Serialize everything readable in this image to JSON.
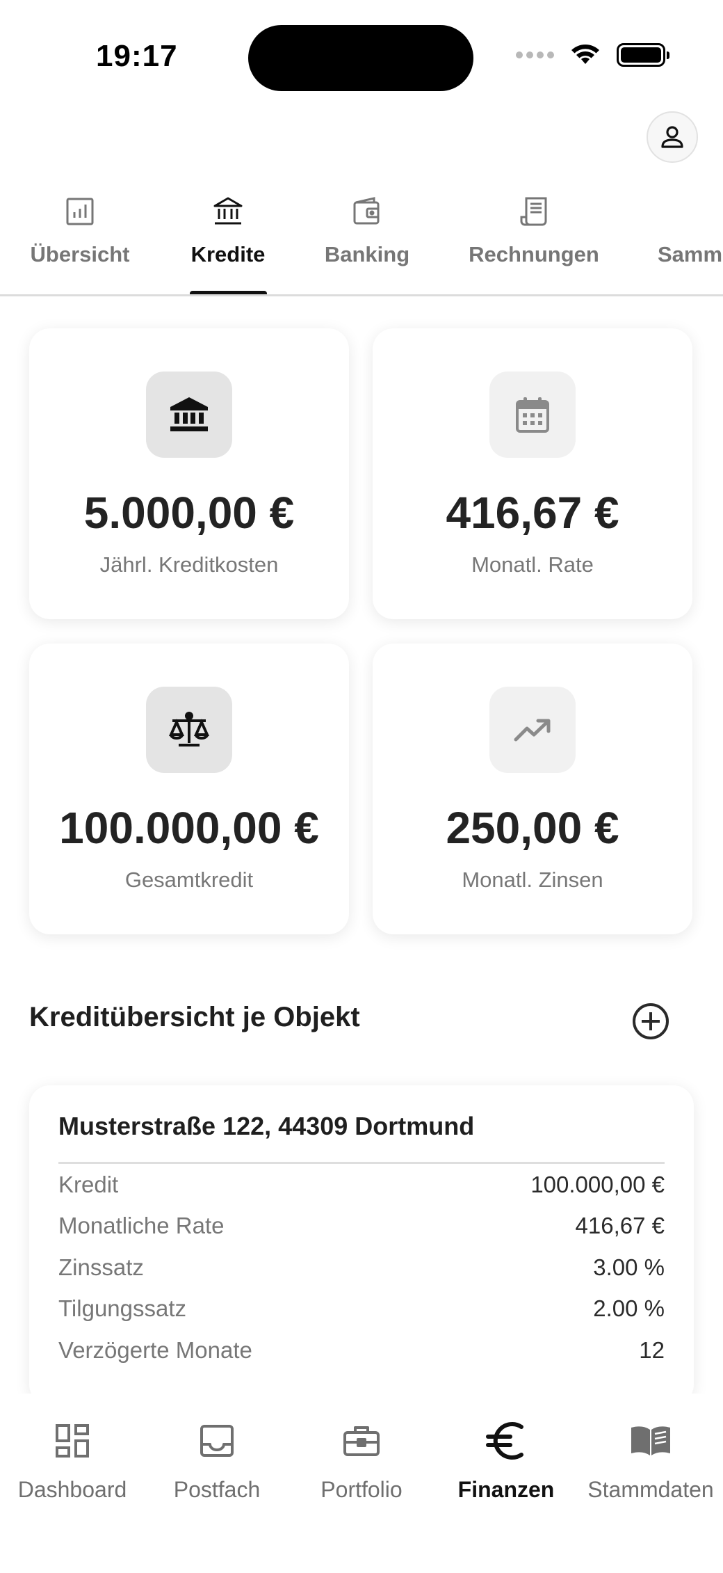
{
  "status_bar": {
    "time": "19:17"
  },
  "header": {
    "profile_icon": "person-icon"
  },
  "tabs": [
    {
      "label": "Übersicht",
      "icon": "bar-chart-icon",
      "active": false
    },
    {
      "label": "Kredite",
      "icon": "bank-icon",
      "active": true
    },
    {
      "label": "Banking",
      "icon": "wallet-icon",
      "active": false
    },
    {
      "label": "Rechnungen",
      "icon": "receipt-icon",
      "active": false
    },
    {
      "label": "Samm",
      "icon": "",
      "active": false
    }
  ],
  "stats": [
    {
      "value": "5.000,00 €",
      "label": "Jährl. Kreditkosten",
      "icon": "bank-icon"
    },
    {
      "value": "416,67 €",
      "label": "Monatl. Rate",
      "icon": "calendar-icon"
    },
    {
      "value": "100.000,00 €",
      "label": "Gesamtkredit",
      "icon": "scale-icon"
    },
    {
      "value": "250,00 €",
      "label": "Monatl. Zinsen",
      "icon": "trending-up-icon"
    }
  ],
  "section": {
    "title": "Kreditübersicht je Objekt",
    "add_icon": "add-circle-icon"
  },
  "object": {
    "title": "Musterstraße 122, 44309 Dortmund",
    "rows": [
      {
        "label": "Kredit",
        "value": "100.000,00 €"
      },
      {
        "label": "Monatliche Rate",
        "value": "416,67 €"
      },
      {
        "label": "Zinssatz",
        "value": "3.00 %"
      },
      {
        "label": "Tilgungssatz",
        "value": "2.00 %"
      },
      {
        "label": "Verzögerte Monate",
        "value": "12"
      }
    ]
  },
  "bottom_nav": [
    {
      "label": "Dashboard",
      "icon": "dashboard-icon",
      "active": false
    },
    {
      "label": "Postfach",
      "icon": "inbox-icon",
      "active": false
    },
    {
      "label": "Portfolio",
      "icon": "briefcase-icon",
      "active": false
    },
    {
      "label": "Finanzen",
      "icon": "euro-icon",
      "active": true
    },
    {
      "label": "Stammdaten",
      "icon": "book-icon",
      "active": false
    }
  ],
  "colors": {
    "text": "#1f1f1f",
    "muted": "#777777",
    "icon_box": "#e4e4e4"
  }
}
